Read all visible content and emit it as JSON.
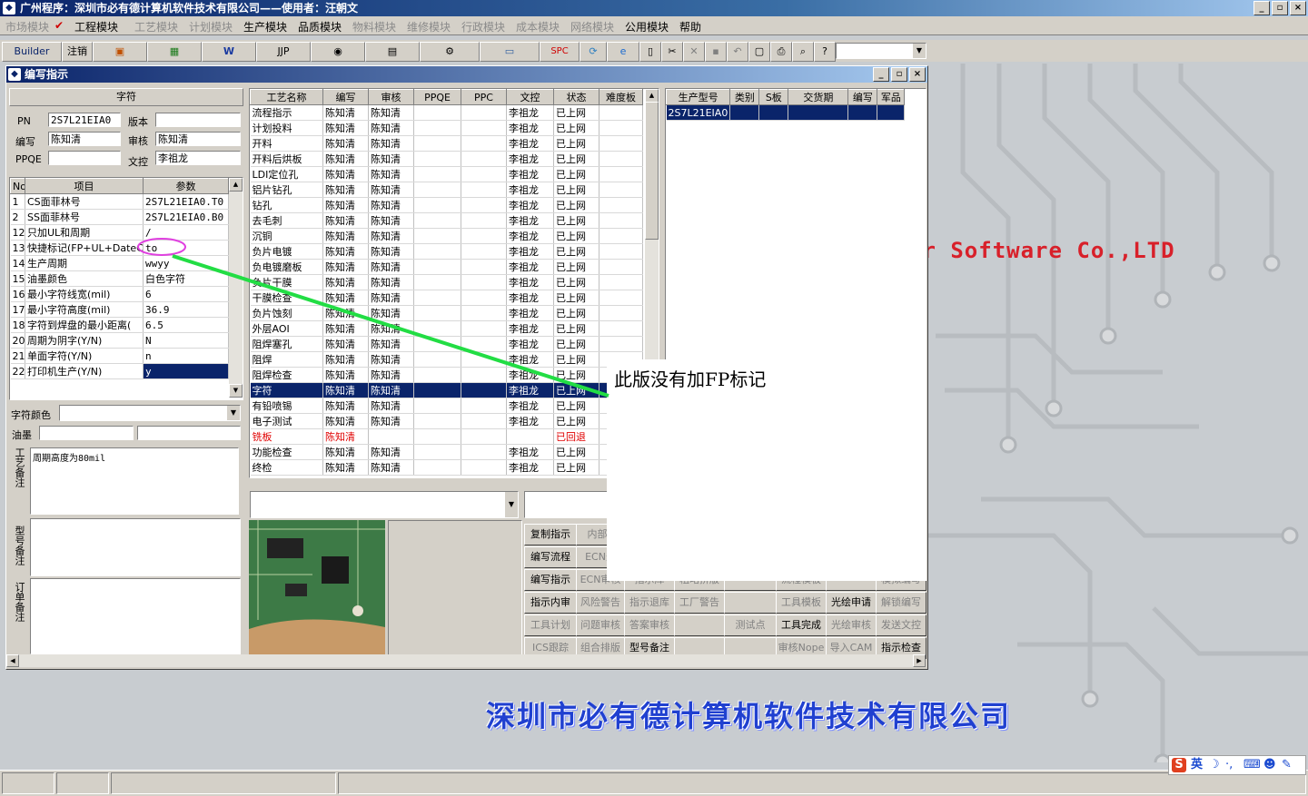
{
  "app": {
    "title": "广州程序：深圳市必有德计算机软件技术有限公司——使用者：汪朝文"
  },
  "menu": [
    {
      "label": "市场模块",
      "enabled": false
    },
    {
      "label": "工程模块",
      "enabled": true,
      "checked": true
    },
    {
      "label": "工艺模块",
      "enabled": false
    },
    {
      "label": "计划模块",
      "enabled": false
    },
    {
      "label": "生产模块",
      "enabled": true
    },
    {
      "label": "品质模块",
      "enabled": true
    },
    {
      "label": "物料模块",
      "enabled": false
    },
    {
      "label": "维修模块",
      "enabled": false
    },
    {
      "label": "行政模块",
      "enabled": false
    },
    {
      "label": "成本模块",
      "enabled": false
    },
    {
      "label": "网络模块",
      "enabled": false
    },
    {
      "label": "公用模块",
      "enabled": true
    },
    {
      "label": "帮助",
      "enabled": true
    }
  ],
  "toolbar": {
    "builder": "Builder",
    "logout": "注销",
    "jjp": "JJP",
    "spc": "SPC"
  },
  "window": {
    "title": "编写指示"
  },
  "left": {
    "section_title": "字符",
    "pn_label": "PN",
    "pn_value": "2S7L21EIA0",
    "version_label": "版本",
    "version_value": "",
    "writer_label": "编写",
    "writer_value": "陈知清",
    "reviewer_label": "审核",
    "reviewer_value": "陈知清",
    "ppqe_label": "PPQE",
    "ppqe_value": "",
    "control_label": "文控",
    "control_value": "李祖龙",
    "params_headers": [
      "No",
      "项目",
      "参数"
    ],
    "params": [
      {
        "no": "1",
        "item": "CS面菲林号",
        "value": "2S7L21EIA0.T0"
      },
      {
        "no": "2",
        "item": "SS面菲林号",
        "value": "2S7L21EIA0.B0"
      },
      {
        "no": "12",
        "item": "只加UL和周期",
        "value": "/"
      },
      {
        "no": "13",
        "item": "快捷标记(FP+UL+DateC",
        "value": "to"
      },
      {
        "no": "14",
        "item": "生产周期",
        "value": "wwyy"
      },
      {
        "no": "15",
        "item": "油墨颜色",
        "value": "白色字符"
      },
      {
        "no": "16",
        "item": "最小字符线宽(mil)",
        "value": "6"
      },
      {
        "no": "17",
        "item": "最小字符高度(mil)",
        "value": "36.9"
      },
      {
        "no": "18",
        "item": "字符到焊盘的最小距离(",
        "value": "6.5"
      },
      {
        "no": "20",
        "item": "周期为阴字(Y/N)",
        "value": "N"
      },
      {
        "no": "21",
        "item": "单面字符(Y/N)",
        "value": "n"
      },
      {
        "no": "22",
        "item": "打印机生产(Y/N)",
        "value": "y"
      }
    ],
    "char_color_label": "字符颜色",
    "ink_label": "油墨",
    "process_note_label": "工艺备注",
    "process_note_value": "周期高度为80mil",
    "model_note_label": "型号备注",
    "order_note_label": "订单备注"
  },
  "process": {
    "headers": [
      "工艺名称",
      "编写",
      "审核",
      "PPQE",
      "PPC",
      "文控",
      "状态",
      "难度板"
    ],
    "rows": [
      [
        "流程指示",
        "陈知清",
        "陈知清",
        "",
        "",
        "李祖龙",
        "已上网",
        ""
      ],
      [
        "计划投料",
        "陈知清",
        "陈知清",
        "",
        "",
        "李祖龙",
        "已上网",
        ""
      ],
      [
        "开料",
        "陈知清",
        "陈知清",
        "",
        "",
        "李祖龙",
        "已上网",
        ""
      ],
      [
        "开料后烘板",
        "陈知清",
        "陈知清",
        "",
        "",
        "李祖龙",
        "已上网",
        ""
      ],
      [
        "LDI定位孔",
        "陈知清",
        "陈知清",
        "",
        "",
        "李祖龙",
        "已上网",
        ""
      ],
      [
        "铝片钻孔",
        "陈知清",
        "陈知清",
        "",
        "",
        "李祖龙",
        "已上网",
        ""
      ],
      [
        "钻孔",
        "陈知清",
        "陈知清",
        "",
        "",
        "李祖龙",
        "已上网",
        ""
      ],
      [
        "去毛刺",
        "陈知清",
        "陈知清",
        "",
        "",
        "李祖龙",
        "已上网",
        ""
      ],
      [
        "沉铜",
        "陈知清",
        "陈知清",
        "",
        "",
        "李祖龙",
        "已上网",
        ""
      ],
      [
        "负片电镀",
        "陈知清",
        "陈知清",
        "",
        "",
        "李祖龙",
        "已上网",
        ""
      ],
      [
        "负电镀磨板",
        "陈知清",
        "陈知清",
        "",
        "",
        "李祖龙",
        "已上网",
        ""
      ],
      [
        "负片干膜",
        "陈知清",
        "陈知清",
        "",
        "",
        "李祖龙",
        "已上网",
        ""
      ],
      [
        "干膜检查",
        "陈知清",
        "陈知清",
        "",
        "",
        "李祖龙",
        "已上网",
        ""
      ],
      [
        "负片蚀刻",
        "陈知清",
        "陈知清",
        "",
        "",
        "李祖龙",
        "已上网",
        ""
      ],
      [
        "外层AOI",
        "陈知清",
        "陈知清",
        "",
        "",
        "李祖龙",
        "已上网",
        ""
      ],
      [
        "阻焊塞孔",
        "陈知清",
        "陈知清",
        "",
        "",
        "李祖龙",
        "已上网",
        ""
      ],
      [
        "阻焊",
        "陈知清",
        "陈知清",
        "",
        "",
        "李祖龙",
        "已上网",
        ""
      ],
      [
        "阻焊检查",
        "陈知清",
        "陈知清",
        "",
        "",
        "李祖龙",
        "已上网",
        ""
      ],
      [
        "字符",
        "陈知清",
        "陈知清",
        "",
        "",
        "李祖龙",
        "已上网",
        ""
      ],
      [
        "有铅喷锡",
        "陈知清",
        "陈知清",
        "",
        "",
        "李祖龙",
        "已上网",
        ""
      ],
      [
        "电子测试",
        "陈知清",
        "陈知清",
        "",
        "",
        "李祖龙",
        "已上网",
        ""
      ],
      [
        "铣板",
        "陈知清",
        "",
        "",
        "",
        "",
        "已回退",
        ""
      ],
      [
        "功能检查",
        "陈知清",
        "陈知清",
        "",
        "",
        "李祖龙",
        "已上网",
        ""
      ],
      [
        "终检",
        "陈知清",
        "陈知清",
        "",
        "",
        "李祖龙",
        "已上网",
        ""
      ]
    ],
    "selected_index": 18,
    "returned_index": 21
  },
  "models": {
    "headers": [
      "生产型号",
      "类别",
      "S板",
      "交货期",
      "编写",
      "军品"
    ],
    "rows": [
      [
        "2S7L21EIA0",
        "",
        "",
        "",
        "",
        ""
      ]
    ]
  },
  "buttons": [
    [
      "复制指示",
      "内部E",
      "",
      "",
      "",
      "",
      "",
      ""
    ],
    [
      "编写流程",
      "ECN影",
      "",
      "",
      "",
      "",
      "",
      ""
    ],
    [
      "编写指示",
      "ECN审核",
      "指示库",
      "粗略拼版",
      "",
      "流程模板",
      "",
      "模拟编写"
    ],
    [
      "指示内审",
      "风险警告",
      "指示退库",
      "工厂警告",
      "",
      "工具模板",
      "光绘申请",
      "解锁编写"
    ],
    [
      "工具计划",
      "问题审核",
      "答案审核",
      "",
      "测试点",
      "工具完成",
      "光绘审核",
      "发送文控"
    ],
    [
      "ICS跟踪",
      "组合排版",
      "型号备注",
      "",
      "",
      "审核Nope",
      "导入CAM",
      "指示检查"
    ]
  ],
  "buttons_disabled": [
    "内部E",
    "ECN影",
    "ECN审核",
    "指示库",
    "粗略拼版",
    "流程模板",
    "模拟编写",
    "风险警告",
    "指示退库",
    "工厂警告",
    "工具模板",
    "解锁编写",
    "工具计划",
    "问题审核",
    "答案审核",
    "测试点",
    "光绘审核",
    "发送文控",
    "ICS跟踪",
    "组合排版",
    "审核Nope",
    "导入CAM"
  ],
  "note_overlay": "此版没有加FP标记",
  "background": {
    "brand": "er Software Co.,LTD",
    "company": "深圳市必有德计算机软件技术有限公司"
  },
  "ime": {
    "label": "英"
  },
  "colors": {
    "selection": "#0a246a",
    "returned": "#e00000",
    "annotation": "#22dd44",
    "highlight_circle": "#e040e0"
  }
}
